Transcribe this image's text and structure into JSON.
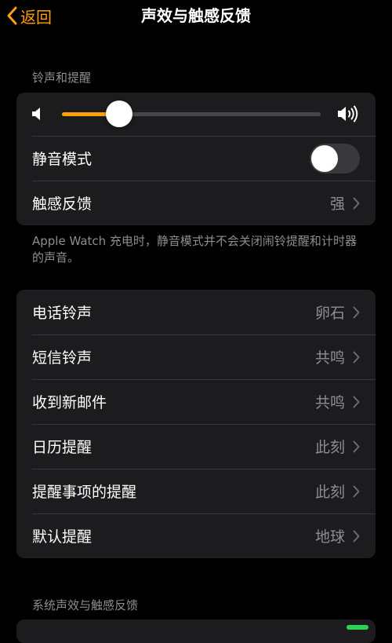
{
  "nav": {
    "back_label": "返回",
    "title": "声效与触感反馈"
  },
  "ringtone_section": {
    "header": "铃声和提醒",
    "volume_level": 0.22,
    "silent_mode": {
      "label": "静音模式",
      "on": false
    },
    "haptics": {
      "label": "触感反馈",
      "value": "强"
    },
    "footnote": "Apple Watch 充电时，静音模式并不会关闭闹铃提醒和计时器的声音。"
  },
  "sounds_section": {
    "items": [
      {
        "label": "电话铃声",
        "value": "卵石"
      },
      {
        "label": "短信铃声",
        "value": "共鸣"
      },
      {
        "label": "收到新邮件",
        "value": "共鸣"
      },
      {
        "label": "日历提醒",
        "value": "此刻"
      },
      {
        "label": "提醒事项的提醒",
        "value": "此刻"
      },
      {
        "label": "默认提醒",
        "value": "地球"
      }
    ]
  },
  "system_section": {
    "header": "系统声效与触感反馈"
  },
  "colors": {
    "accent": "#ff9f0a",
    "background": "#000000",
    "card": "#1c1c1e",
    "secondary_text": "#8d8d93",
    "toggle_on": "#30d158"
  }
}
